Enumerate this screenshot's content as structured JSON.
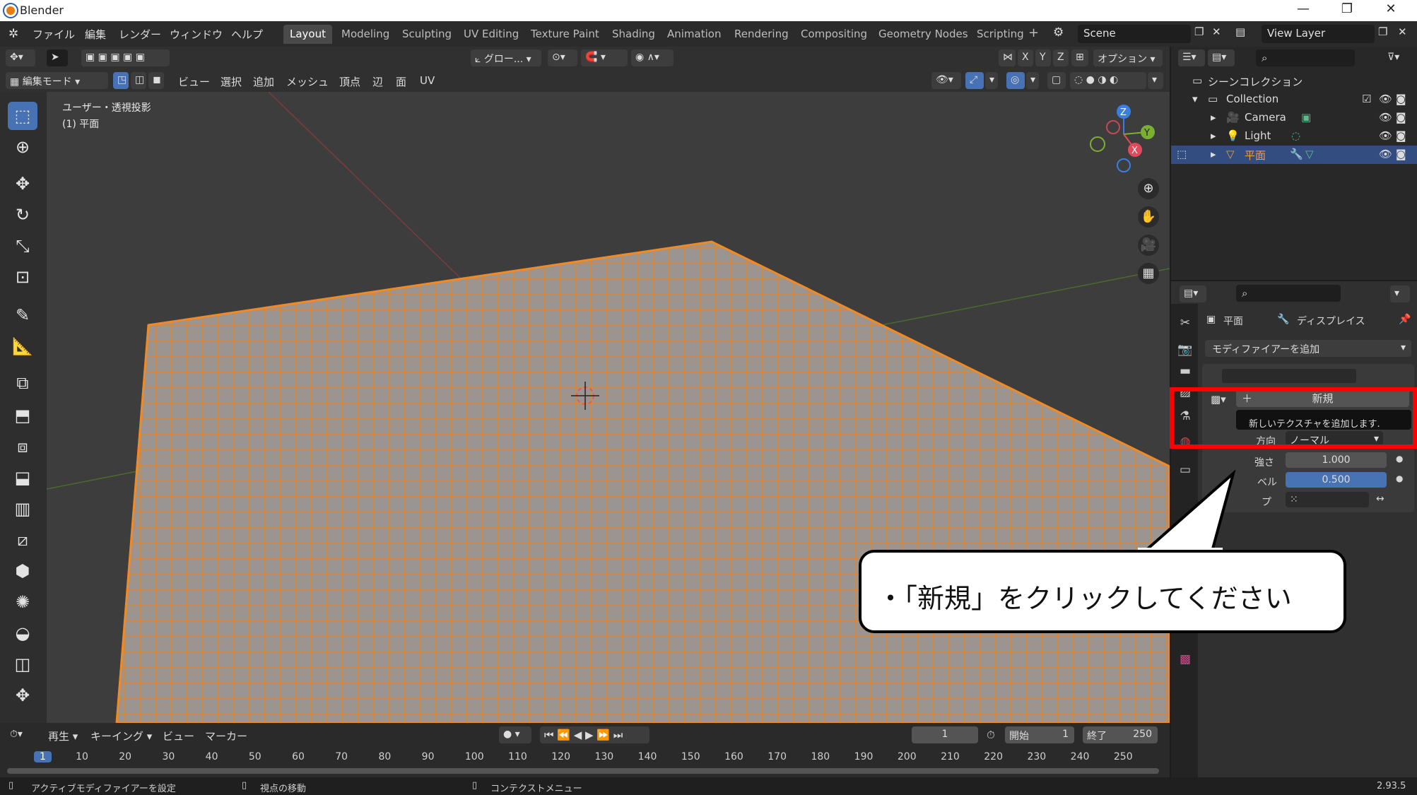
{
  "window": {
    "title": "Blender",
    "minimize": "—",
    "maximize": "❐",
    "close": "✕"
  },
  "menu": {
    "items": [
      "ファイル",
      "編集",
      "レンダー",
      "ウィンドウ",
      "ヘルプ"
    ]
  },
  "workspaces": {
    "tabs": [
      "Layout",
      "Modeling",
      "Sculpting",
      "UV Editing",
      "Texture Paint",
      "Shading",
      "Animation",
      "Rendering",
      "Compositing",
      "Geometry Nodes",
      "Scripting"
    ],
    "active": "Layout",
    "add": "+"
  },
  "scene": {
    "label": "Scene"
  },
  "view_layer": {
    "label": "View Layer"
  },
  "header1": {
    "transform_orientation": "グロー...",
    "options": "オプション",
    "x": "X",
    "y": "Y",
    "z": "Z"
  },
  "header2": {
    "mode": "編集モード",
    "menus": [
      "ビュー",
      "選択",
      "追加",
      "メッシュ",
      "頂点",
      "辺",
      "面",
      "UV"
    ]
  },
  "viewport": {
    "view_name": "ユーザー・透視投影",
    "object_label": "(1) 平面",
    "gizmo": {
      "x": "X",
      "y": "Y",
      "z": "Z"
    }
  },
  "outliner": {
    "scene_collection": "シーンコレクション",
    "items": [
      {
        "label": "Collection"
      },
      {
        "label": "Camera"
      },
      {
        "label": "Light"
      },
      {
        "label": "平面"
      }
    ]
  },
  "properties": {
    "object_name": "平面",
    "modifier_name": "ディスプレイス",
    "add_modifier": "モディファイアーを追加",
    "new_button": "新規",
    "tooltip": "新しいテクスチャを追加します.",
    "direction_label": "方向",
    "direction_value": "ノーマル",
    "strength_label": "強さ",
    "strength_value": "1.000",
    "midlevel_label": "ベル",
    "midlevel_value": "0.500",
    "type_label": "プ"
  },
  "timeline": {
    "menus": [
      "再生",
      "キーイング",
      "ビュー",
      "マーカー"
    ],
    "current_frame": "1",
    "start_label": "開始",
    "start_value": "1",
    "end_label": "終了",
    "end_value": "250",
    "ticks": [
      "1",
      "10",
      "20",
      "30",
      "40",
      "50",
      "60",
      "70",
      "80",
      "90",
      "100",
      "110",
      "120",
      "130",
      "140",
      "150",
      "160",
      "170",
      "180",
      "190",
      "200",
      "210",
      "220",
      "230",
      "240",
      "250"
    ]
  },
  "status": {
    "left": "アクティブモディファイアーを設定",
    "middle": "視点の移動",
    "right": "コンテクストメニュー",
    "version": "2.93.5"
  },
  "callout": {
    "text": "・「新規」をクリックしてください"
  },
  "colors": {
    "accent": "#4772b3",
    "mesh": "#e8841f",
    "highlight": "#ff0000",
    "selected_row": "#334d80"
  }
}
